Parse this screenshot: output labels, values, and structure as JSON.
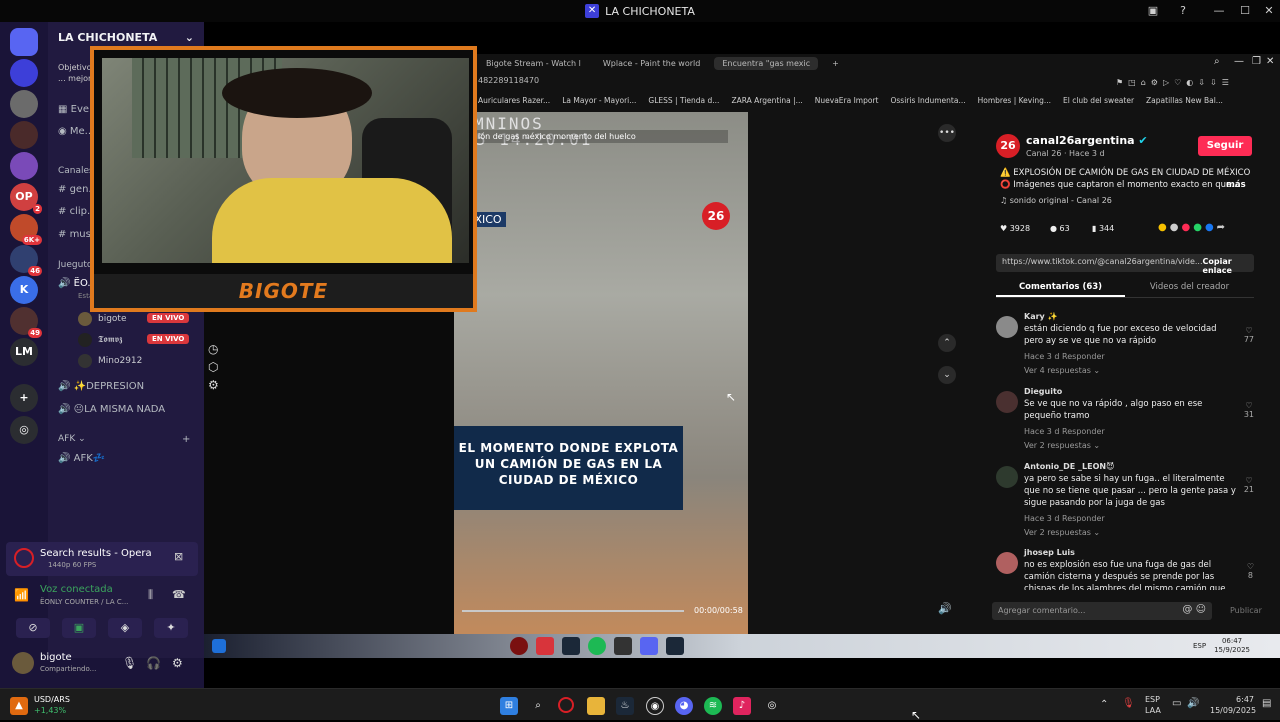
{
  "window": {
    "title": "LA CHICHONETA"
  },
  "rail": {
    "servers": [
      {
        "label": "",
        "color": "#5865f2",
        "badge": ""
      },
      {
        "label": "",
        "color": "#3d3fd9",
        "badge": ""
      },
      {
        "label": "",
        "color": "#6b6b6b",
        "badge": ""
      },
      {
        "label": "",
        "color": "#4a2a2a",
        "badge": ""
      },
      {
        "label": "",
        "color": "#7a4ab8",
        "badge": ""
      },
      {
        "label": "OP",
        "color": "#d04040",
        "badge": "2"
      },
      {
        "label": "",
        "color": "#c04a2a",
        "badge": "6K+"
      },
      {
        "label": "",
        "color": "#304070",
        "badge": "46"
      },
      {
        "label": "K",
        "color": "#3a6ee8",
        "badge": ""
      },
      {
        "label": "",
        "color": "#503030",
        "badge": "49"
      },
      {
        "label": "LM",
        "color": "#2b2d31",
        "badge": ""
      }
    ]
  },
  "channels": {
    "server_name": "LA CHICHONETA",
    "notice": "Objetivo ... mejora",
    "events": "Eve...",
    "members": "Me...",
    "section_text": "Canales de texto",
    "text_channels": [
      "gen...",
      "clip...",
      "mus..."
    ],
    "section_games": "Juegutos",
    "active_voice": "ЁO...",
    "active_voice_sub": "Esta...",
    "users": [
      {
        "name": "bigote",
        "live": "EN VIVO"
      },
      {
        "name": "𝕿𝖔𝖒𝖛𝖟",
        "live": "EN VIVO"
      },
      {
        "name": "Mino2912",
        "live": ""
      }
    ],
    "voice_channels": [
      "✨DEPRESION",
      "😐LA MISMA NADA"
    ],
    "afk_section": "AFK",
    "afk_channel": "AFK💤"
  },
  "streamer": {
    "name": "BIGOTE"
  },
  "voice_panel": {
    "activity_title": "Search results - Opera",
    "activity_sub": "1440p 60 FPS",
    "connected": "Voz conectada",
    "connected_sub": "ЁONLY COUNTER / LA C...",
    "user": "bigote",
    "user_status": "Compartiendo..."
  },
  "ticker": {
    "label": "USD/ARS",
    "change": "+1,43%"
  },
  "browser": {
    "tabs": [
      "Bigote Stream - Watch l",
      "Wplace - Paint the world",
      "Encuentra \"gas mexic"
    ],
    "address": "482289118470",
    "bookmarks": [
      "Auriculares Razer...",
      "La Mayor - Mayori...",
      "GLESS | Tienda d...",
      "ZARA Argentina |...",
      "NuevaEra Import",
      "Ossiris Indumenta...",
      "Hombres | Keving...",
      "El club del sweater",
      "Zapatillas New Bal..."
    ]
  },
  "video": {
    "overlay_top": "MNINOS",
    "overlay_time": "5 14:20:01",
    "search_text": "ión de gas méxico momento del huelco",
    "location": "MÉXICO",
    "brand": "26",
    "caption": "EL MOMENTO DONDE EXPLOTA UN CAMIÓN DE GAS EN LA CIUDAD DE MÉXICO",
    "time": "00:00/00:58"
  },
  "post": {
    "channel": "canal26argentina",
    "meta": "Canal 26 · Hace 3 d",
    "follow": "Seguir",
    "line1": "⚠️ EXPLOSIÓN DE CAMIÓN DE GAS EN CIUDAD DE MÉXICO",
    "line2": "⭕ Imágenes que captaron el momento exacto en que...",
    "more": "más",
    "sound": "♫ sonido original - Canal 26",
    "likes": "3928",
    "comments": "63",
    "saves": "344",
    "url": "https://www.tiktok.com/@canal26argentina/vide...",
    "copy": "Copiar enlace",
    "tab_comments": "Comentarios (63)",
    "tab_videos": "Videos del creador",
    "comment_placeholder": "Agregar comentario...",
    "publish": "Publicar"
  },
  "comments": [
    {
      "name": "Kary ✨",
      "text": "están diciendo q fue por exceso de velocidad pero ay se ve que no va rápido",
      "meta": "Hace 3 d     Responder",
      "replies": "Ver 4 respuestas ⌄",
      "likes": "77"
    },
    {
      "name": "Dieguito",
      "text": "Se ve que no va rápido , algo paso en ese pequeño tramo",
      "meta": "Hace 3 d     Responder",
      "replies": "Ver 2 respuestas ⌄",
      "likes": "31"
    },
    {
      "name": "Antonio_DE _LEON😈",
      "text": "ya pero se sabe si hay un fuga.. el literalmente que no se tiene que pasar ... pero la gente pasa y sigue pasando por la juga de gas",
      "meta": "Hace 3 d     Responder",
      "replies": "Ver 2 respuestas ⌄",
      "likes": "21"
    },
    {
      "name": "jhosep Luis",
      "text": "no es explosión eso fue una fuga de gas del camión cisterna y después se prende por las chispas de los alambres del mismo camión que",
      "meta": "",
      "replies": "",
      "likes": "8"
    }
  ],
  "inner_tray": {
    "lang": "ESP",
    "time": "06:47",
    "date": "15/9/2025"
  },
  "tray": {
    "lang1": "ESP",
    "lang2": "LAA",
    "time": "6:47",
    "date": "15/09/2025"
  }
}
